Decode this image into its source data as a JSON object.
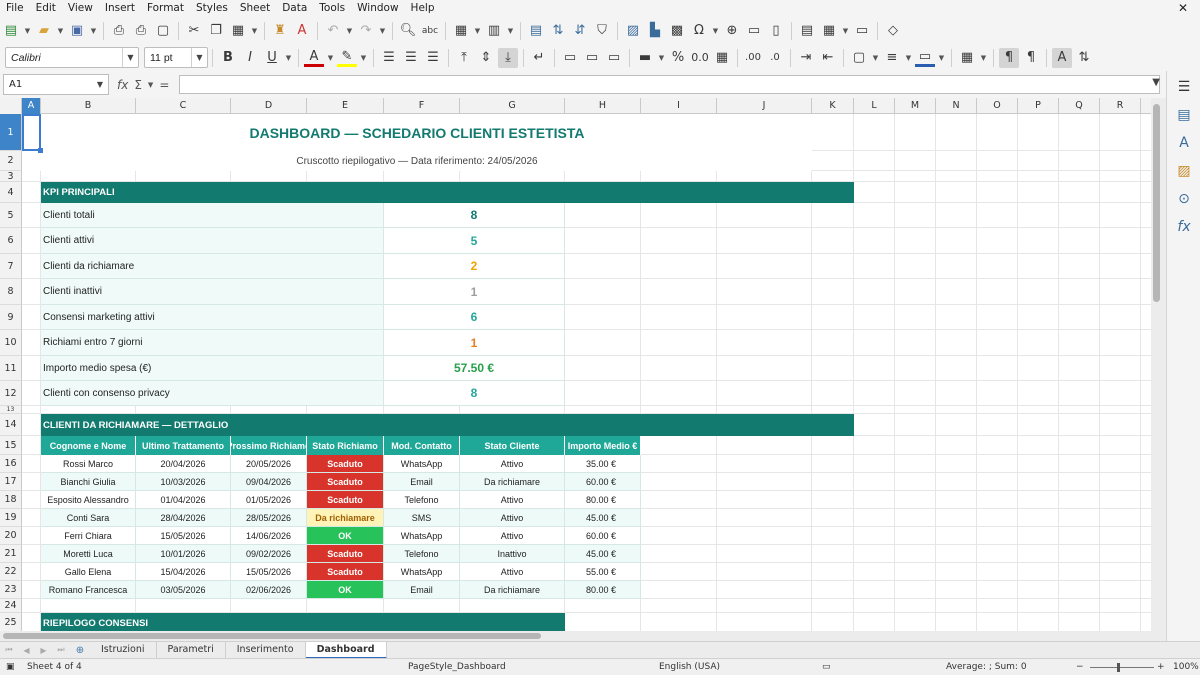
{
  "menu": [
    "File",
    "Edit",
    "View",
    "Insert",
    "Format",
    "Styles",
    "Sheet",
    "Data",
    "Tools",
    "Window",
    "Help"
  ],
  "font": {
    "name": "Calibri",
    "size": "11 pt"
  },
  "namebox": "A1",
  "columns": [
    "A",
    "B",
    "C",
    "D",
    "E",
    "F",
    "G",
    "H",
    "I",
    "J",
    "K",
    "L",
    "M",
    "N",
    "O",
    "P",
    "Q",
    "R"
  ],
  "rows": [
    "1",
    "2",
    "3",
    "4",
    "5",
    "6",
    "7",
    "8",
    "9",
    "10",
    "11",
    "12",
    "13",
    "14",
    "15",
    "16",
    "17",
    "18",
    "19",
    "20",
    "21",
    "22",
    "23",
    "24",
    "25"
  ],
  "colors": {
    "header_teal": "#127a6f",
    "kpi_label_bg": "#f0fbf9",
    "red": "#d9342b",
    "green": "#27c25a",
    "yellow_bg": "#fff3b8",
    "blue_select": "#3e84c8"
  },
  "title": "DASHBOARD — SCHEDARIO CLIENTI ESTETISTA",
  "subtitle": "Cruscotto riepilogativo — Data riferimento: 24/05/2026",
  "kpi": {
    "header": "KPI PRINCIPALI",
    "items": [
      {
        "label": "Clienti totali",
        "value": "8",
        "color": "#127a6f"
      },
      {
        "label": "Clienti attivi",
        "value": "5",
        "color": "#26a69a"
      },
      {
        "label": "Clienti da richiamare",
        "value": "2",
        "color": "#f0a500"
      },
      {
        "label": "Clienti inattivi",
        "value": "1",
        "color": "#9e9e9e"
      },
      {
        "label": "Consensi marketing attivi",
        "value": "6",
        "color": "#26a69a"
      },
      {
        "label": "Richiami entro 7 giorni",
        "value": "1",
        "color": "#e67e22"
      },
      {
        "label": "Importo medio spesa (€)",
        "value": "57.50 €",
        "color": "#27a04a"
      },
      {
        "label": "Clienti con consenso privacy",
        "value": "8",
        "color": "#26a69a"
      }
    ]
  },
  "detail": {
    "header": "CLIENTI DA RICHIAMARE — DETTAGLIO",
    "columns": [
      "Cognome e Nome",
      "Ultimo Trattamento",
      "Prossimo Richiamo",
      "Stato Richiamo",
      "Mod. Contatto",
      "Stato Cliente",
      "Importo Medio €"
    ],
    "rows": [
      {
        "name": "Rossi Marco",
        "last": "20/04/2026",
        "next": "20/05/2026",
        "status": "Scaduto",
        "kind": "red",
        "contact": "WhatsApp",
        "state": "Attivo",
        "amount": "35.00 €"
      },
      {
        "name": "Bianchi Giulia",
        "last": "10/03/2026",
        "next": "09/04/2026",
        "status": "Scaduto",
        "kind": "red",
        "contact": "Email",
        "state": "Da richiamare",
        "amount": "60.00 €"
      },
      {
        "name": "Esposito Alessandro",
        "last": "01/04/2026",
        "next": "01/05/2026",
        "status": "Scaduto",
        "kind": "red",
        "contact": "Telefono",
        "state": "Attivo",
        "amount": "80.00 €"
      },
      {
        "name": "Conti Sara",
        "last": "28/04/2026",
        "next": "28/05/2026",
        "status": "Da richiamare",
        "kind": "yellow",
        "contact": "SMS",
        "state": "Attivo",
        "amount": "45.00 €"
      },
      {
        "name": "Ferri Chiara",
        "last": "15/05/2026",
        "next": "14/06/2026",
        "status": "OK",
        "kind": "green",
        "contact": "WhatsApp",
        "state": "Attivo",
        "amount": "60.00 €"
      },
      {
        "name": "Moretti Luca",
        "last": "10/01/2026",
        "next": "09/02/2026",
        "status": "Scaduto",
        "kind": "red",
        "contact": "Telefono",
        "state": "Inattivo",
        "amount": "45.00 €"
      },
      {
        "name": "Gallo Elena",
        "last": "15/04/2026",
        "next": "15/05/2026",
        "status": "Scaduto",
        "kind": "red",
        "contact": "WhatsApp",
        "state": "Attivo",
        "amount": "55.00 €"
      },
      {
        "name": "Romano Francesca",
        "last": "03/05/2026",
        "next": "02/06/2026",
        "status": "OK",
        "kind": "green",
        "contact": "Email",
        "state": "Da richiamare",
        "amount": "80.00 €"
      }
    ]
  },
  "consent_header": "RIEPILOGO CONSENSI",
  "tabs": [
    "Istruzioni",
    "Parametri",
    "Inserimento",
    "Dashboard"
  ],
  "active_tab": "Dashboard",
  "status": {
    "sheet": "Sheet 4 of 4",
    "page_style": "PageStyle_Dashboard",
    "language": "English (USA)",
    "summary": "Average: ; Sum: 0",
    "zoom": "100%"
  }
}
